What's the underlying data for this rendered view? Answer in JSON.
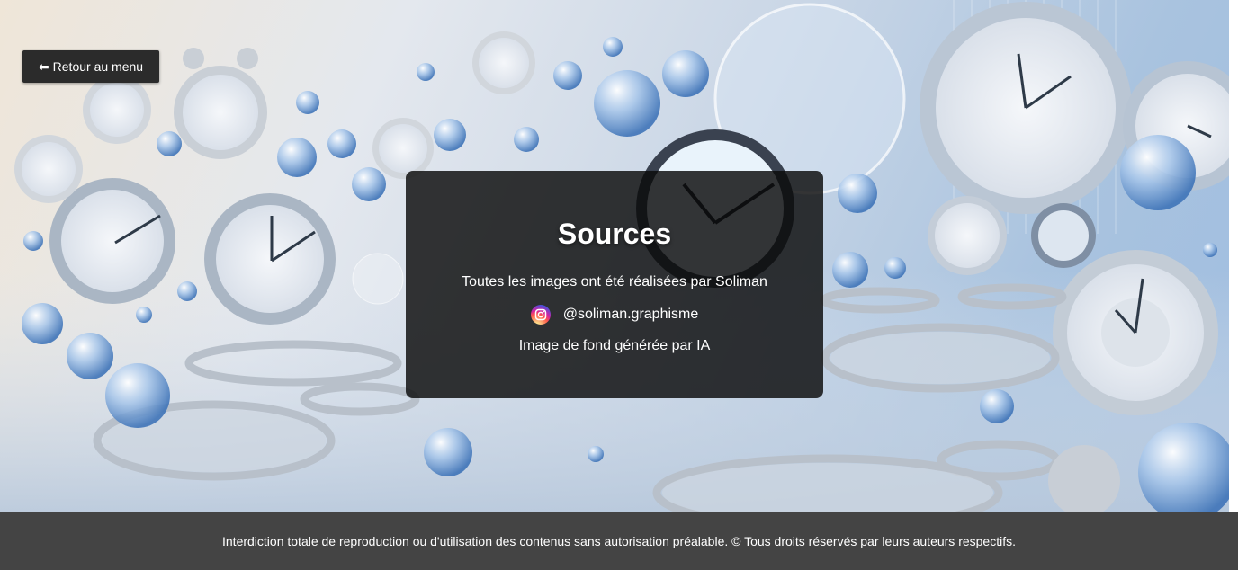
{
  "nav": {
    "back_label": "Retour au menu",
    "back_icon": "arrow-left-icon"
  },
  "sources": {
    "title": "Sources",
    "credit": "Toutes les images ont été réalisées par Soliman",
    "instagram_handle": "@soliman.graphisme",
    "instagram_icon": "instagram-icon",
    "background_note": "Image de fond générée par IA"
  },
  "footer": {
    "text": "Interdiction totale de reproduction ou d'utilisation des contenus sans autorisation préalable. © Tous droits réservés par leurs auteurs respectifs."
  },
  "colors": {
    "button_bg": "#2b2b2b",
    "panel_bg": "rgba(10,10,10,0.82)",
    "footer_bg": "#444444",
    "text": "#ffffff"
  }
}
